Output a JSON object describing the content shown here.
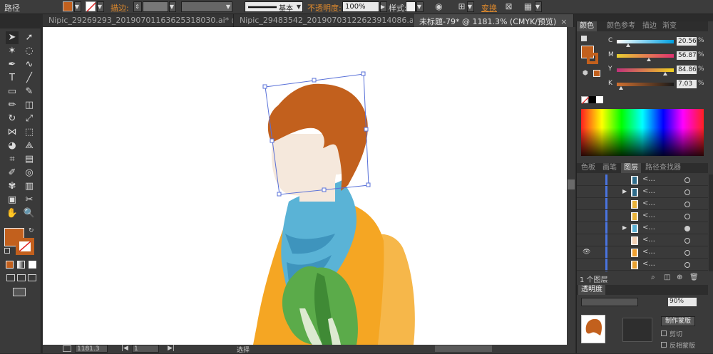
{
  "control_bar": {
    "object_type": "路径",
    "stroke_label": "描边:",
    "stroke_style": "基本",
    "opacity_label": "不透明度:",
    "opacity_value": "100%",
    "style_label": "样式:",
    "transform_label": "变换",
    "fill_color": "#c2601d"
  },
  "tabs": [
    {
      "label": "Nipic_29269293_20190701163625318030.ai* @ 33..."
    },
    {
      "label": "Nipic_29483542_20190703122623914086.ai* @ 33..."
    },
    {
      "label": "未标题-79* @ 1181.3% (CMYK/预览)"
    }
  ],
  "tab_close": "×",
  "tools": {
    "icons": [
      "selection-icon",
      "direct-selection-icon",
      "magic-wand-icon",
      "lasso-icon",
      "pen-icon",
      "curvature-icon",
      "type-icon",
      "line-icon",
      "rectangle-icon",
      "paintbrush-icon",
      "pencil-icon",
      "eraser-icon",
      "rotate-icon",
      "scale-icon",
      "width-icon",
      "free-transform-icon",
      "shape-builder-icon",
      "perspective-icon",
      "mesh-icon",
      "gradient-icon",
      "eyedropper-icon",
      "blend-icon",
      "symbol-sprayer-icon",
      "column-graph-icon",
      "artboard-icon",
      "slice-icon",
      "hand-icon",
      "zoom-icon"
    ],
    "glyphs": [
      "➤",
      "➚",
      "✶",
      "◌",
      "✒",
      "∿",
      "T",
      "╱",
      "▭",
      "✎",
      "✏",
      "◫",
      "↻",
      "⤢",
      "⋈",
      "⬚",
      "◕",
      "⟁",
      "⌗",
      "▤",
      "✐",
      "◎",
      "✾",
      "▥",
      "▣",
      "✂",
      "✋",
      "🔍"
    ],
    "fill_color": "#c2601d",
    "stroke_color": "#c2601d"
  },
  "status": {
    "zoom": "1181.3",
    "page": "1",
    "tool_name": "选择"
  },
  "color_panel": {
    "tabs": [
      "颜色",
      "颜色参考",
      "描边",
      "渐变"
    ],
    "channels": [
      {
        "name": "C",
        "value": "20.56",
        "level": 0.2056
      },
      {
        "name": "M",
        "value": "56.87",
        "level": 0.5687
      },
      {
        "name": "Y",
        "value": "84.86",
        "level": 0.8486
      },
      {
        "name": "K",
        "value": "7.03",
        "level": 0.0703
      }
    ],
    "percent": "%",
    "fill_color": "#c2601d"
  },
  "layers_panel": {
    "tabs": [
      "色板",
      "画笔",
      "图层",
      "路径查找器"
    ],
    "rows": [
      {
        "name": "<...",
        "thumb_color": "#2f6d8c"
      },
      {
        "name": "<...",
        "thumb_color": "#2f6d8c"
      },
      {
        "name": "<...",
        "thumb_color": "#e8b23a"
      },
      {
        "name": "<...",
        "thumb_color": "#e8b23a"
      },
      {
        "name": "<...",
        "thumb_color": "#5bb0d3"
      },
      {
        "name": "<...",
        "thumb_color": "#f3d1b5"
      },
      {
        "name": "<...",
        "thumb_color": "#f0a030"
      },
      {
        "name": "<...",
        "thumb_color": "#e8a030"
      }
    ],
    "count_label": "1 个图层"
  },
  "transparency_panel": {
    "title": "透明度",
    "opacity": "90%",
    "make_mask": "制作蒙版",
    "clip": "剪切",
    "invert_mask": "反相蒙版"
  },
  "canvas": {
    "hair_color": "#c2601d",
    "skin_color": "#f5e8dc",
    "scarf_color": "#5ab3d6",
    "shirt_color": "#f5a623",
    "arm_color": "#f6b74a",
    "leaf_color": "#5bab4a"
  }
}
